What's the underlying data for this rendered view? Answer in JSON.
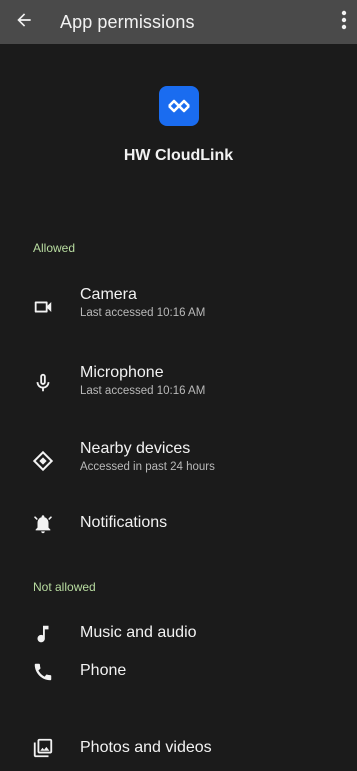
{
  "topbar": {
    "title": "App permissions",
    "back_icon": "arrow-back-icon",
    "overflow_icon": "more-vert-icon"
  },
  "app": {
    "name": "HW CloudLink",
    "icon": "cloudlink-logo-icon",
    "icon_color": "#1a6cf0"
  },
  "sections": {
    "allowed_label": "Allowed",
    "not_allowed_label": "Not allowed",
    "label_color": "#b8dca0"
  },
  "allowed": [
    {
      "title": "Camera",
      "subtitle": "Last accessed 10:16 AM",
      "icon": "videocam-icon"
    },
    {
      "title": "Microphone",
      "subtitle": "Last accessed 10:16 AM",
      "icon": "mic-icon"
    },
    {
      "title": "Nearby devices",
      "subtitle": "Accessed in past 24 hours",
      "icon": "nearby-devices-icon"
    },
    {
      "title": "Notifications",
      "icon": "notifications-icon"
    }
  ],
  "not_allowed": [
    {
      "title": "Music and audio",
      "icon": "music-note-icon"
    },
    {
      "title": "Phone",
      "icon": "phone-icon"
    },
    {
      "title": "Photos and videos",
      "icon": "photo-library-icon"
    }
  ]
}
